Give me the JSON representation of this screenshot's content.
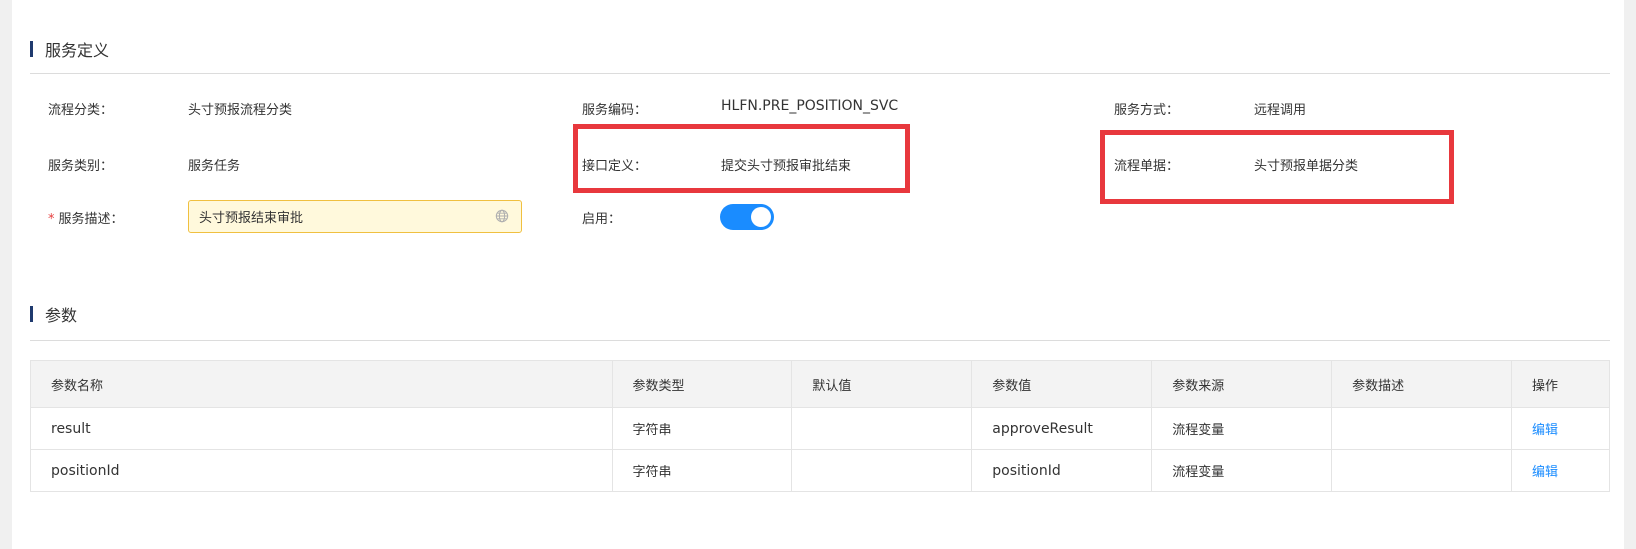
{
  "service_definition": {
    "title": "服务定义",
    "fields": {
      "process_category": {
        "label": "流程分类：",
        "value": "头寸预报流程分类"
      },
      "service_code": {
        "label": "服务编码：",
        "value": "HLFN.PRE_POSITION_SVC"
      },
      "service_mode": {
        "label": "服务方式：",
        "value": "远程调用"
      },
      "service_type": {
        "label": "服务类别：",
        "value": "服务任务"
      },
      "interface_def": {
        "label": "接口定义：",
        "value": "提交头寸预报审批结束"
      },
      "process_document": {
        "label": "流程单据：",
        "value": "头寸预报单据分类"
      },
      "service_desc": {
        "required_mark": "*",
        "label": "服务描述：",
        "value": "头寸预报结束审批"
      },
      "enabled": {
        "label": "启用：",
        "value": true
      }
    }
  },
  "params": {
    "title": "参数",
    "columns": [
      "参数名称",
      "参数类型",
      "默认值",
      "参数值",
      "参数来源",
      "参数描述",
      "操作"
    ],
    "rows": [
      {
        "name": "result",
        "type": "字符串",
        "default": "",
        "value": "approveResult",
        "source": "流程变量",
        "desc": "",
        "action": "编辑"
      },
      {
        "name": "positionId",
        "type": "字符串",
        "default": "",
        "value": "positionId",
        "source": "流程变量",
        "desc": "",
        "action": "编辑"
      }
    ]
  },
  "colors": {
    "accent": "#1a8cff",
    "section_bar": "#1f3a6e",
    "highlight": "#e8383d",
    "required": "#e53e3e",
    "input_bg": "#fff9dc",
    "input_border": "#f0c040"
  },
  "icons": {
    "input_suffix": "globe-icon",
    "toggle": "switch-on"
  }
}
